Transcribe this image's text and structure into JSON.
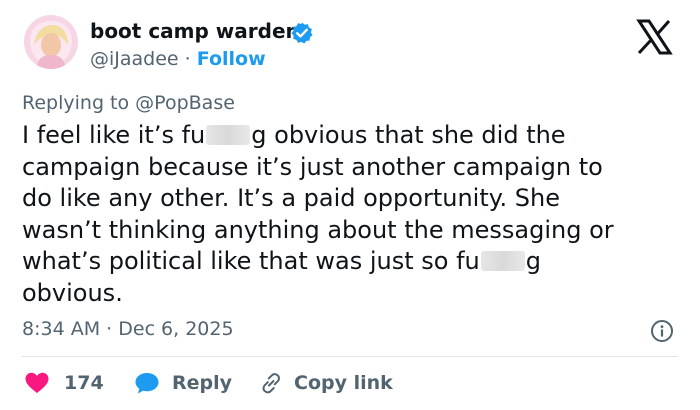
{
  "tweet": {
    "display_name": "boot camp warden",
    "handle": "@iJaadee",
    "separator": "·",
    "follow_label": "Follow",
    "replying_prefix": "Replying to",
    "replying_handle": "@PopBase",
    "body_lines": [
      [
        "I feel like it’s fu",
        "g obvious that she did the"
      ],
      [
        "campaign because it’s just another campaign to"
      ],
      [
        "do like any other. It’s a paid opportunity. She"
      ],
      [
        "wasn’t thinking anything about the messaging or"
      ],
      [
        "what’s political like that was just so fu",
        "g"
      ],
      [
        "obvious."
      ]
    ],
    "time": "8:34 AM",
    "date": "Dec 6, 2025",
    "likes_count": "174",
    "reply_label": "Reply",
    "copy_link_label": "Copy link"
  },
  "colors": {
    "text": "#0f1419",
    "secondary": "#536471",
    "accent": "#1d9bf0",
    "like": "#f91880",
    "divider": "#e1e8ed"
  },
  "icons": {
    "platform": "x-logo-icon",
    "verified": "verified-badge-icon",
    "info": "info-icon",
    "like": "heart-icon",
    "reply": "speech-bubble-icon",
    "copy": "link-icon"
  }
}
